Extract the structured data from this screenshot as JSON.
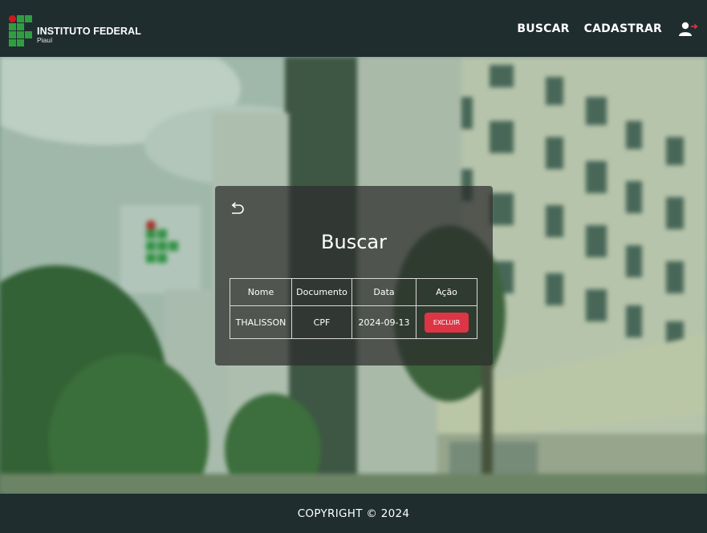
{
  "header": {
    "logo_title": "INSTITUTO FEDERAL",
    "logo_subtitle": "Piauí",
    "nav": {
      "buscar_label": "BUSCAR",
      "cadastrar_label": "CADASTRAR"
    },
    "logout_icon": "user-logout-icon"
  },
  "card": {
    "back_icon": "return-arrow-icon",
    "title": "Buscar",
    "table": {
      "headers": [
        "Nome",
        "Documento",
        "Data",
        "Ação"
      ],
      "rows": [
        {
          "nome": "THALISSON",
          "documento": "CPF",
          "data": "2024-09-13",
          "action_label": "EXCLUIR"
        }
      ]
    }
  },
  "footer": {
    "copyright": "COPYRIGHT © 2024"
  },
  "colors": {
    "header_bg": "#1f2d2f",
    "brand_green": "#2f9e41",
    "brand_red": "#cd191e",
    "danger": "#dc3545"
  }
}
